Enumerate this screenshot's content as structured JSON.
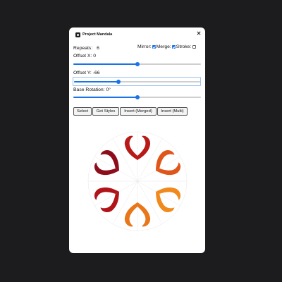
{
  "window": {
    "title": "Project Mandala",
    "close_icon": "close-icon",
    "app_icon": "app-icon"
  },
  "controls": {
    "repeats_label": "Repeats:",
    "repeats_value": "6",
    "offset_x_label": "Offset X: 0",
    "offset_x_level": 0.5,
    "offset_y_label": "Offset Y: -66",
    "offset_y_level": 0.35,
    "base_rotation_label": "Base Rotation: 0°",
    "base_rotation_level": 0.5
  },
  "toggles": {
    "mirror_label": "Mirror:",
    "mirror_checked": true,
    "merge_label": "Merge:",
    "merge_checked": true,
    "stroke_label": "Stroke:",
    "stroke_checked": false
  },
  "buttons": {
    "select": "Select",
    "get_styles": "Get Styles",
    "insert_merged": "Insert (Merged)",
    "insert_multi": "Insert (Multi)"
  },
  "colors": {
    "background": "#1c1c1f",
    "accent": "#1a73e8",
    "shape_dark": "#8e0d1a",
    "shape_mid": "#d63a14",
    "shape_light": "#f59c1a"
  }
}
